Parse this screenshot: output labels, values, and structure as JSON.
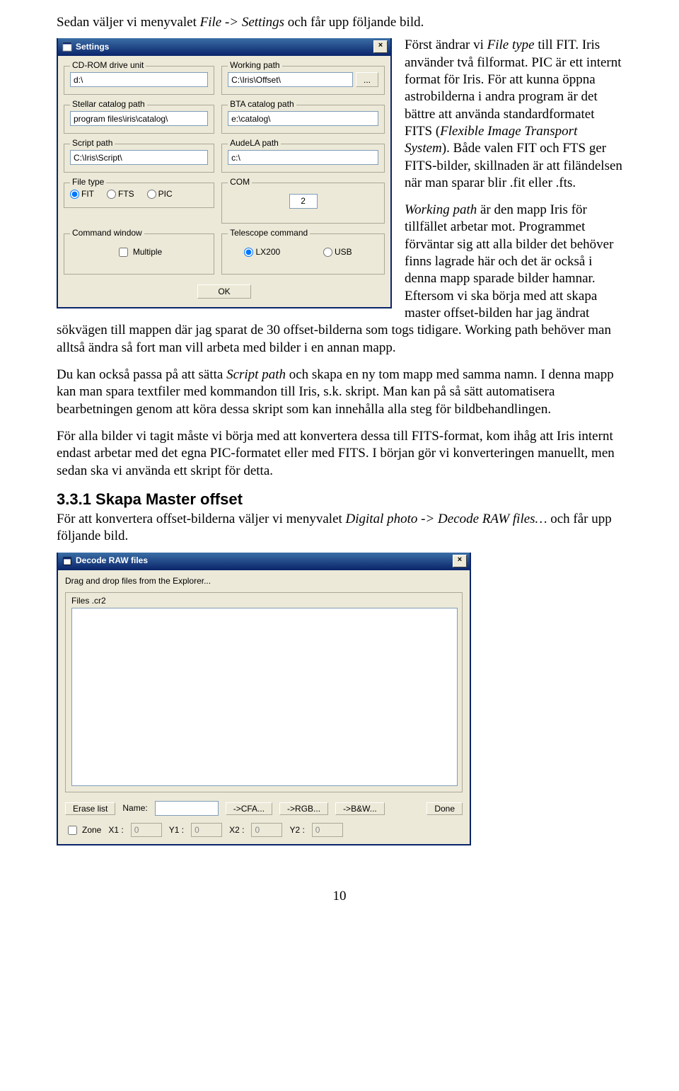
{
  "intro_prefix": "Sedan väljer vi menyvalet ",
  "intro_italic": "File -> Settings",
  "intro_suffix": " och får upp följande bild.",
  "settings": {
    "title": "Settings",
    "cd_label": "CD-ROM drive unit",
    "cd_value": "d:\\",
    "working_label": "Working path",
    "working_value": "C:\\Iris\\Offset\\",
    "working_browse": "...",
    "stellar_label": "Stellar catalog path",
    "stellar_value": "program files\\iris\\catalog\\",
    "bta_label": "BTA catalog path",
    "bta_value": "e:\\catalog\\",
    "script_label": "Script path",
    "script_value": "C:\\Iris\\Script\\",
    "audela_label": "AudeLA path",
    "audela_value": "c:\\",
    "filetype_label": "File type",
    "ft_fit": "FIT",
    "ft_fts": "FTS",
    "ft_pic": "PIC",
    "com_label": "COM",
    "com_value": "2",
    "cmd_label": "Command window",
    "cmd_multiple": "Multiple",
    "tele_label": "Telescope command",
    "tele_lx": "LX200",
    "tele_usb": "USB",
    "ok": "OK"
  },
  "p1a": "Först ändrar vi ",
  "p1b": "File type",
  "p1c": " till FIT. Iris använder två filformat. PIC är ett internt format för Iris. För att kunna öppna astrobilderna i andra program är det bättre att använda standardformatet FITS (",
  "p1d": "Flexible Image Transport System",
  "p1e": "). Både valen FIT och FTS ger FITS-bilder, skillnaden är att filändelsen när man sparar blir .fit eller .fts.",
  "p2a": "Working path",
  "p2b": " är den mapp Iris för tillfället arbetar mot. Programmet förväntar sig att alla bilder det behöver finns lagrade här och det är också i denna mapp sparade bilder hamnar. Eftersom vi ska börja med att skapa master offset-bilden har jag ändrat sökvägen till mappen där jag sparat de 30 offset-bilderna som togs tidigare. Working path behöver man alltså ändra så fort man vill arbeta med bilder i en annan mapp.",
  "p3a": "Du kan också passa på att sätta ",
  "p3b": "Script path",
  "p3c": " och skapa en ny tom mapp med samma namn. I denna mapp kan man spara textfiler med kommandon till Iris, s.k. skript. Man kan på så sätt automatisera bearbetningen genom att köra dessa skript som kan innehålla alla steg för bildbehandlingen.",
  "p4": "För alla bilder vi tagit måste vi börja med att konvertera dessa till FITS-format, kom ihåg att Iris internt endast arbetar med det egna PIC-formatet eller med FITS. I början gör vi konverteringen manuellt, men sedan ska vi använda ett skript för detta.",
  "heading": "3.3.1 Skapa Master offset",
  "p5a": "För att konvertera offset-bilderna väljer vi menyvalet ",
  "p5b": "Digital photo -> Decode RAW files…",
  "p5c": " och får upp följande bild.",
  "decode": {
    "title": "Decode RAW files",
    "drag": "Drag and drop files from the Explorer...",
    "files_tab": "Files .cr2",
    "erase": "Erase list",
    "name_lbl": "Name:",
    "cfa": "->CFA...",
    "rgb": "->RGB...",
    "bw": "->B&W...",
    "done": "Done",
    "zone": "Zone",
    "x1": "X1 :",
    "x1v": "0",
    "y1": "Y1 :",
    "y1v": "0",
    "x2": "X2 :",
    "x2v": "0",
    "y2": "Y2 :",
    "y2v": "0"
  },
  "page_number": "10"
}
